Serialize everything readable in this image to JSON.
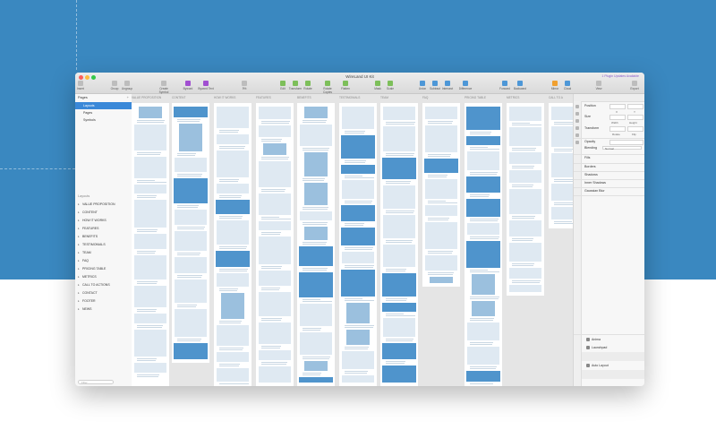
{
  "window": {
    "title": "WireLand UI Kit",
    "plugin_notice": "1 Plugin Updates Available"
  },
  "toolbar": {
    "items": [
      {
        "label": "Insert",
        "icon": "plus-icon"
      },
      {
        "label": "Group",
        "icon": "group-icon"
      },
      {
        "label": "Ungroup",
        "icon": "ungroup-icon"
      },
      {
        "label": "Create Symbol",
        "icon": "symbol-icon"
      },
      {
        "label": "Byword",
        "icon": "byword-icon"
      },
      {
        "label": "Byword Text",
        "icon": "byword-text-icon"
      },
      {
        "label": "9%",
        "icon": "zoom-icon"
      },
      {
        "label": "Edit",
        "icon": "edit-icon"
      },
      {
        "label": "Transform",
        "icon": "transform-icon"
      },
      {
        "label": "Rotate",
        "icon": "rotate-icon"
      },
      {
        "label": "Rotate Copies",
        "icon": "rotate-copies-icon"
      },
      {
        "label": "Flatten",
        "icon": "flatten-icon"
      },
      {
        "label": "Mask",
        "icon": "mask-icon"
      },
      {
        "label": "Scale",
        "icon": "scale-icon"
      },
      {
        "label": "Union",
        "icon": "union-icon"
      },
      {
        "label": "Subtract",
        "icon": "subtract-icon"
      },
      {
        "label": "Intersect",
        "icon": "intersect-icon"
      },
      {
        "label": "Difference",
        "icon": "difference-icon"
      },
      {
        "label": "Forward",
        "icon": "forward-icon"
      },
      {
        "label": "Backward",
        "icon": "backward-icon"
      },
      {
        "label": "Mirror",
        "icon": "mirror-icon"
      },
      {
        "label": "Cloud",
        "icon": "cloud-icon"
      },
      {
        "label": "View",
        "icon": "view-icon"
      },
      {
        "label": "Export",
        "icon": "export-icon"
      }
    ]
  },
  "sidebar": {
    "pages_heading": "Pages",
    "pages": [
      {
        "label": "Layouts",
        "selected": true
      },
      {
        "label": "Pages",
        "selected": false
      },
      {
        "label": "Symbols",
        "selected": false
      }
    ],
    "layers_heading": "Layouts",
    "layers": [
      "VALUE PROPOSITION",
      "CONTENT",
      "HOW IT WORKS",
      "FEATURES",
      "BENEFITS",
      "TESTIMONIALS",
      "TEAM",
      "FAQ",
      "PRICING TABLE",
      "METRICS",
      "CALL TO ACTIONS",
      "CONTACT",
      "FOOTER",
      "NEWS"
    ],
    "filter_placeholder": "Filter"
  },
  "canvas": {
    "artboards": [
      "VALUE PROPOSITION",
      "CONTENT",
      "HOW IT WORKS",
      "FEATURES",
      "BENEFITS",
      "TESTIMONIALS",
      "TEAM",
      "FAQ",
      "PRICING TABLE",
      "METRICS",
      "CALL TO A"
    ]
  },
  "inspector": {
    "position_label": "Position",
    "x_label": "X",
    "y_label": "Y",
    "size_label": "Size",
    "width_label": "Width",
    "height_label": "Height",
    "transform_label": "Transform",
    "rotate_label": "Rotate",
    "flip_label": "Flip",
    "opacity_label": "Opacity",
    "blending_label": "Blending",
    "blending_value": "Normal",
    "fills_label": "Fills",
    "borders_label": "Borders",
    "shadows_label": "Shadows",
    "inner_shadows_label": "Inner Shadows",
    "blur_label": "Gaussian Blur",
    "plugins": [
      "Anima",
      "Launchpad",
      "Auto Layout"
    ]
  },
  "colors": {
    "background": "#3a88c0",
    "selection": "#3a88d8",
    "wireframe_accent": "#4f94cc"
  }
}
